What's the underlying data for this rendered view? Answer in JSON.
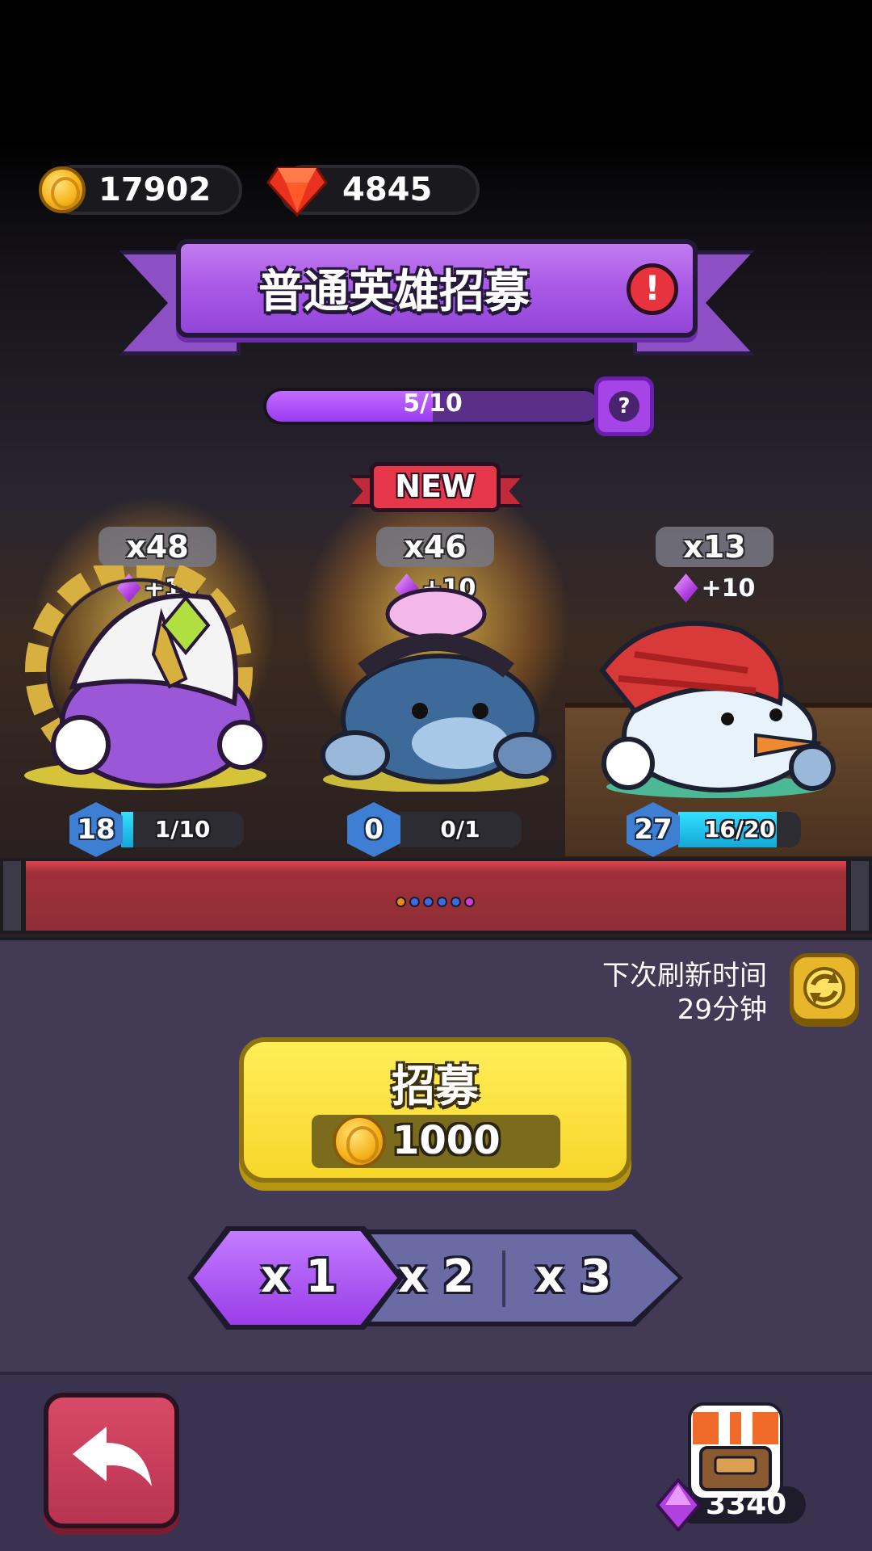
{
  "currency": {
    "gold": "17902",
    "gems": "4845"
  },
  "banner": {
    "title": "普通英雄招募",
    "alert_glyph": "!"
  },
  "progress": {
    "text": "5/10",
    "current": 5,
    "total": 10,
    "help_glyph": "?"
  },
  "new_badge": "NEW",
  "heroes": [
    {
      "count": "x48",
      "bonus": "+10",
      "level": "18",
      "progress_text": "1/10",
      "progress": 0.1,
      "name": "purple-knight-hero"
    },
    {
      "count": "x46",
      "bonus": "+10",
      "level": "0",
      "progress_text": "0/1",
      "progress": 0,
      "name": "fish-hero"
    },
    {
      "count": "x13",
      "bonus": "+10",
      "level": "27",
      "progress_text": "16/20",
      "progress": 0.8,
      "name": "snowman-hero"
    }
  ],
  "page_dots": [
    "#f08a1a",
    "#3a6ae8",
    "#3a6ae8",
    "#3a6ae8",
    "#3a6ae8",
    "#d83ad8"
  ],
  "refresh": {
    "label": "下次刷新时间",
    "time": "29分钟"
  },
  "recruit": {
    "label": "招募",
    "cost": "1000"
  },
  "multipliers": {
    "options": [
      "x 1",
      "x 2",
      "x 3"
    ],
    "selected": "x 1"
  },
  "bottom": {
    "shop_gems": "3340"
  },
  "colors": {
    "panel": "#433b56",
    "banner_purple": "#a957e6",
    "recruit_yellow": "#f8d62a",
    "back_red": "#c83c5a"
  }
}
